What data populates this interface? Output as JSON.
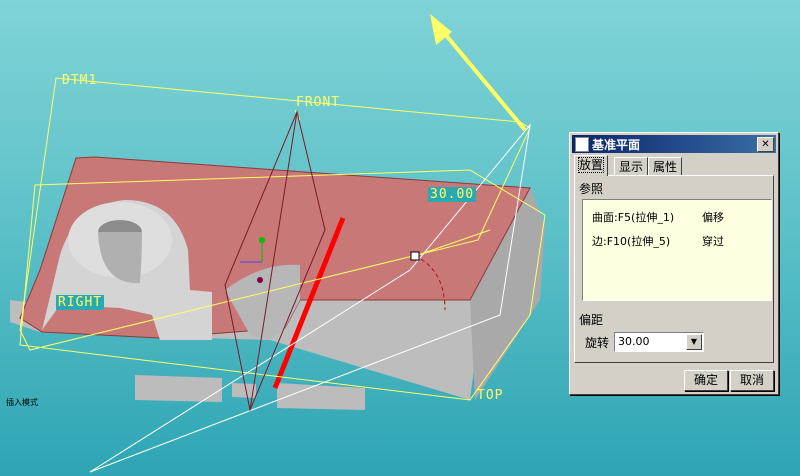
{
  "viewport": {
    "labels": {
      "dtm1": "DTM1",
      "front": "FRONT",
      "right": "RIGHT",
      "top": "TOP",
      "offset_value": "30.00"
    },
    "status_text": "插入模式"
  },
  "dialog": {
    "title": "基准平面",
    "close_glyph": "✕",
    "tabs": [
      {
        "label": "放置",
        "active": true
      },
      {
        "label": "显示",
        "active": false
      },
      {
        "label": "属性",
        "active": false
      }
    ],
    "references_label": "参照",
    "references": [
      {
        "entity": "曲面:F5(拉伸_1)",
        "constraint": "偏移"
      },
      {
        "entity": "边:F10(拉伸_5)",
        "constraint": "穿过"
      }
    ],
    "offset_label": "偏距",
    "rotation_label": "旋转",
    "rotation_value": "30.00",
    "ok_label": "确定",
    "cancel_label": "取消"
  },
  "colors": {
    "datum_plane": "#ffff66",
    "part_top": "#c97878",
    "edge_highlight": "#ff0000"
  }
}
